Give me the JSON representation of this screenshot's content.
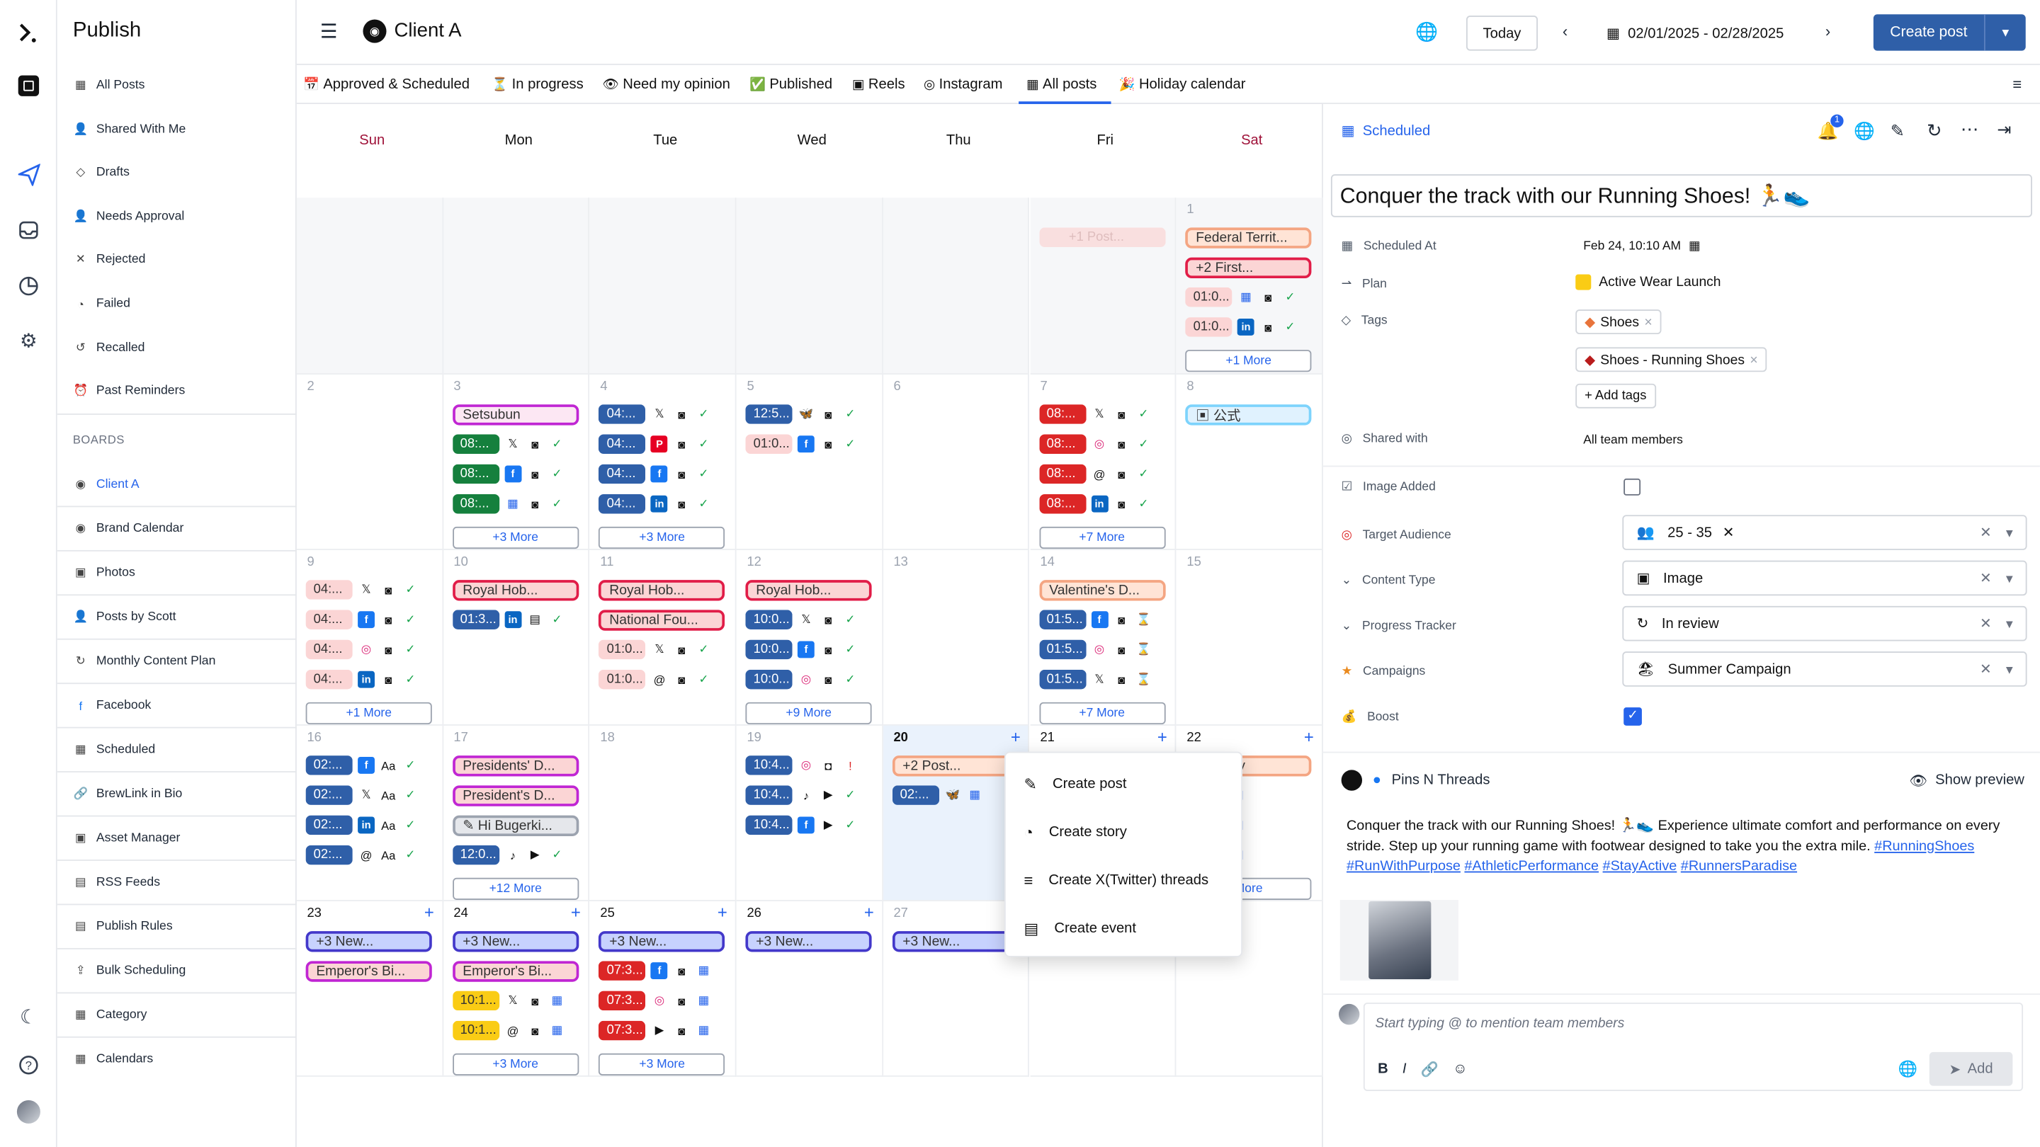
{
  "app": {
    "title": "Publish"
  },
  "sidebar": {
    "items": [
      {
        "icon": "calendar-icon",
        "label": "All Posts"
      },
      {
        "icon": "user-icon",
        "label": "Shared With Me"
      },
      {
        "icon": "draft-icon",
        "label": "Drafts"
      },
      {
        "icon": "user-check-icon",
        "label": "Needs Approval"
      },
      {
        "icon": "close-icon",
        "label": "Rejected"
      },
      {
        "icon": "clock-icon",
        "label": "Failed"
      },
      {
        "icon": "undo-icon",
        "label": "Recalled"
      },
      {
        "icon": "alarm-icon",
        "label": "Past Reminders"
      }
    ],
    "boards_title": "BOARDS",
    "boards": [
      {
        "label": "Client A",
        "active": true
      },
      {
        "label": "Brand Calendar"
      },
      {
        "label": "Photos"
      },
      {
        "label": "Posts by Scott"
      },
      {
        "label": "Monthly Content Plan"
      },
      {
        "label": "Facebook"
      },
      {
        "label": "Scheduled"
      },
      {
        "label": "BrewLink in Bio"
      },
      {
        "label": "Asset Manager"
      },
      {
        "label": "RSS Feeds"
      },
      {
        "label": "Publish Rules"
      },
      {
        "label": "Bulk Scheduling"
      },
      {
        "label": "Category"
      },
      {
        "label": "Calendars"
      }
    ]
  },
  "header": {
    "board": "Client A",
    "today": "Today",
    "range": "02/01/2025 - 02/28/2025",
    "create": "Create post"
  },
  "filters": [
    {
      "icon": "📅",
      "label": "Approved & Scheduled"
    },
    {
      "icon": "⏳",
      "label": "In progress"
    },
    {
      "icon": "👁",
      "label": "Need my opinion"
    },
    {
      "icon": "✅",
      "label": "Published"
    },
    {
      "icon": "▣",
      "label": "Reels"
    },
    {
      "icon": "◎",
      "label": "Instagram"
    },
    {
      "icon": "▦",
      "label": "All posts",
      "active": true
    },
    {
      "icon": "🎉",
      "label": "Holiday calendar"
    }
  ],
  "calendar": {
    "days": [
      "Sun",
      "Mon",
      "Tue",
      "Wed",
      "Thu",
      "Fri",
      "Sat"
    ],
    "cells": [
      {
        "n": "",
        "off": true
      },
      {
        "n": "",
        "off": true
      },
      {
        "n": "",
        "off": true
      },
      {
        "n": "",
        "off": true
      },
      {
        "n": "",
        "off": true
      },
      {
        "n": "",
        "off": true,
        "chips": [
          {
            "t": "+1 Post...",
            "c": "#fbd5d5",
            "tc": "#d4a5a5",
            "faded": true
          }
        ]
      },
      {
        "n": "1",
        "off": true,
        "events": [
          {
            "t": "Federal Territ...",
            "bg": "#ffe4d6",
            "bd": "#f4a582",
            "tc": "#333"
          },
          {
            "t": "+2  First...",
            "bg": "#fbd5d5",
            "bd": "#e11d48",
            "tc": "#333"
          }
        ],
        "chips": [
          {
            "t": "01:0...",
            "c": "#fbd5d5",
            "tc": "#333",
            "icons": [
              "▦",
              "◙",
              "✓"
            ]
          },
          {
            "t": "01:0...",
            "c": "#fbd5d5",
            "tc": "#333",
            "icons": [
              "in",
              "◙",
              "✓"
            ]
          }
        ],
        "more": "+1 More"
      },
      {
        "n": "2"
      },
      {
        "n": "3",
        "events": [
          {
            "t": "Setsubun",
            "bg": "#fce7f3",
            "bd": "#c026d3",
            "tc": "#333"
          }
        ],
        "chips": [
          {
            "t": "08:...",
            "c": "#15803d",
            "icons": [
              "𝕏",
              "◙",
              "✓"
            ]
          },
          {
            "t": "08:...",
            "c": "#15803d",
            "icons": [
              "f",
              "◙",
              "✓"
            ]
          },
          {
            "t": "08:...",
            "c": "#15803d",
            "icons": [
              "▦",
              "◙",
              "✓"
            ]
          }
        ],
        "more": "+3 More"
      },
      {
        "n": "4",
        "chips": [
          {
            "t": "04:...",
            "c": "#2f5fa8",
            "icons": [
              "𝕏",
              "◙",
              "✓"
            ]
          },
          {
            "t": "04:...",
            "c": "#2f5fa8",
            "icons": [
              "P",
              "◙",
              "✓"
            ]
          },
          {
            "t": "04:...",
            "c": "#2f5fa8",
            "icons": [
              "f",
              "◙",
              "✓"
            ]
          },
          {
            "t": "04:...",
            "c": "#2f5fa8",
            "icons": [
              "in",
              "◙",
              "✓"
            ]
          }
        ],
        "more": "+3 More"
      },
      {
        "n": "5",
        "chips": [
          {
            "t": "12:5...",
            "c": "#2f5fa8",
            "icons": [
              "🦋",
              "◙",
              "✓"
            ]
          },
          {
            "t": "01:0...",
            "c": "#fbd5d5",
            "tc": "#333",
            "icons": [
              "f",
              "◙",
              "✓"
            ]
          }
        ]
      },
      {
        "n": "6"
      },
      {
        "n": "7",
        "chips": [
          {
            "t": "08:...",
            "c": "#dc2626",
            "icons": [
              "𝕏",
              "◙",
              "✓"
            ]
          },
          {
            "t": "08:...",
            "c": "#dc2626",
            "icons": [
              "◎",
              "◙",
              "✓"
            ]
          },
          {
            "t": "08:...",
            "c": "#dc2626",
            "icons": [
              "@",
              "◙",
              "✓"
            ]
          },
          {
            "t": "08:...",
            "c": "#dc2626",
            "icons": [
              "in",
              "◙",
              "✓"
            ]
          }
        ],
        "more": "+7 More"
      },
      {
        "n": "8",
        "events": [
          {
            "t": "▣  公式",
            "bg": "#e0f2fe",
            "bd": "#7dd3fc",
            "tc": "#333"
          }
        ]
      },
      {
        "n": "9",
        "chips": [
          {
            "t": "04:...",
            "c": "#fbd5d5",
            "tc": "#333",
            "icons": [
              "𝕏",
              "◙",
              "✓"
            ]
          },
          {
            "t": "04:...",
            "c": "#fbd5d5",
            "tc": "#333",
            "icons": [
              "f",
              "◙",
              "✓"
            ]
          },
          {
            "t": "04:...",
            "c": "#fbd5d5",
            "tc": "#333",
            "icons": [
              "◎",
              "◙",
              "✓"
            ]
          },
          {
            "t": "04:...",
            "c": "#fbd5d5",
            "tc": "#333",
            "icons": [
              "in",
              "◙",
              "✓"
            ]
          }
        ],
        "more": "+1 More"
      },
      {
        "n": "10",
        "events": [
          {
            "t": "Royal Hob...",
            "bg": "#fbd5d5",
            "bd": "#e11d48",
            "tc": "#333"
          }
        ],
        "chips": [
          {
            "t": "01:3...",
            "c": "#2f5fa8",
            "icons": [
              "in",
              "▤",
              "✓"
            ]
          }
        ]
      },
      {
        "n": "11",
        "events": [
          {
            "t": "Royal Hob...",
            "bg": "#fbd5d5",
            "bd": "#e11d48",
            "tc": "#333"
          },
          {
            "t": "National Fou...",
            "bg": "#fbd5d5",
            "bd": "#e11d48",
            "tc": "#333"
          }
        ],
        "chips": [
          {
            "t": "01:0...",
            "c": "#fbd5d5",
            "tc": "#333",
            "icons": [
              "𝕏",
              "◙",
              "✓"
            ]
          },
          {
            "t": "01:0...",
            "c": "#fbd5d5",
            "tc": "#333",
            "icons": [
              "@",
              "◙",
              "✓"
            ]
          }
        ]
      },
      {
        "n": "12",
        "events": [
          {
            "t": "Royal Hob...",
            "bg": "#fbd5d5",
            "bd": "#e11d48",
            "tc": "#333"
          }
        ],
        "chips": [
          {
            "t": "10:0...",
            "c": "#2f5fa8",
            "icons": [
              "𝕏",
              "◙",
              "✓"
            ]
          },
          {
            "t": "10:0...",
            "c": "#2f5fa8",
            "icons": [
              "f",
              "◙",
              "✓"
            ]
          },
          {
            "t": "10:0...",
            "c": "#2f5fa8",
            "icons": [
              "◎",
              "◙",
              "✓"
            ]
          }
        ],
        "more": "+9 More"
      },
      {
        "n": "13"
      },
      {
        "n": "14",
        "events": [
          {
            "t": "Valentine's D...",
            "bg": "#ffe4d6",
            "bd": "#f4a582",
            "tc": "#333"
          }
        ],
        "chips": [
          {
            "t": "01:5...",
            "c": "#2f5fa8",
            "icons": [
              "f",
              "◙",
              "⌛"
            ]
          },
          {
            "t": "01:5...",
            "c": "#2f5fa8",
            "icons": [
              "◎",
              "◙",
              "⌛"
            ]
          },
          {
            "t": "01:5...",
            "c": "#2f5fa8",
            "icons": [
              "𝕏",
              "◙",
              "⌛"
            ]
          }
        ],
        "more": "+7 More"
      },
      {
        "n": "15"
      },
      {
        "n": "16",
        "chips": [
          {
            "t": "02:...",
            "c": "#2f5fa8",
            "icons": [
              "f",
              "Aa",
              "✓"
            ]
          },
          {
            "t": "02:...",
            "c": "#2f5fa8",
            "icons": [
              "𝕏",
              "Aa",
              "✓"
            ]
          },
          {
            "t": "02:...",
            "c": "#2f5fa8",
            "icons": [
              "in",
              "Aa",
              "✓"
            ]
          },
          {
            "t": "02:...",
            "c": "#2f5fa8",
            "icons": [
              "@",
              "Aa",
              "✓"
            ]
          }
        ]
      },
      {
        "n": "17",
        "events": [
          {
            "t": "Presidents' D...",
            "bg": "#fbd5d5",
            "bd": "#c026d3",
            "tc": "#333"
          },
          {
            "t": "President's D...",
            "bg": "#fbd5d5",
            "bd": "#c026d3",
            "tc": "#333"
          },
          {
            "t": "✎  Hi Bugerki...",
            "bg": "#e5e7eb",
            "bd": "#9ca3af",
            "tc": "#333"
          }
        ],
        "chips": [
          {
            "t": "12:0...",
            "c": "#2f5fa8",
            "icons": [
              "♪",
              "▶",
              "✓"
            ]
          }
        ],
        "more": "+12 More"
      },
      {
        "n": "18"
      },
      {
        "n": "19",
        "chips": [
          {
            "t": "10:4...",
            "c": "#2f5fa8",
            "icons": [
              "◎",
              "◘",
              "!"
            ]
          },
          {
            "t": "10:4...",
            "c": "#2f5fa8",
            "icons": [
              "♪",
              "▶",
              "✓"
            ]
          },
          {
            "t": "10:4...",
            "c": "#2f5fa8",
            "icons": [
              "f",
              "▶",
              "✓"
            ]
          }
        ]
      },
      {
        "n": "20",
        "today": true,
        "plus": true,
        "events": [
          {
            "t": "+2  Post...",
            "bg": "#ffe4d6",
            "bd": "#f4a582",
            "tc": "#333"
          }
        ],
        "chips": [
          {
            "t": "02:...",
            "c": "#2f5fa8",
            "icons": [
              "🦋",
              "▦"
            ]
          }
        ]
      },
      {
        "n": "21",
        "plus": true
      },
      {
        "n": "22",
        "plus": true,
        "events": [
          {
            "t": "ling Day",
            "bg": "#ffe4d6",
            "bd": "#f4a582",
            "tc": "#333"
          }
        ],
        "chips": [
          {
            "t": "",
            "c": "transparent",
            "icons": [
              "𝕏",
              "▶",
              "▦"
            ]
          },
          {
            "t": "",
            "c": "transparent",
            "icons": [
              "◎",
              "◘",
              "▦"
            ]
          },
          {
            "t": "",
            "c": "transparent",
            "icons": [
              "▶",
              "◘",
              "▦"
            ]
          }
        ],
        "more": "More"
      },
      {
        "n": "23",
        "plus": true,
        "events": [
          {
            "t": "+3  New...",
            "bg": "#c7d2fe",
            "bd": "#4338ca",
            "tc": "#333"
          },
          {
            "t": "Emperor's Bi...",
            "bg": "#fbd5d5",
            "bd": "#c026d3",
            "tc": "#333"
          }
        ]
      },
      {
        "n": "24",
        "plus": true,
        "events": [
          {
            "t": "+3  New...",
            "bg": "#c7d2fe",
            "bd": "#4338ca",
            "tc": "#333"
          },
          {
            "t": "Emperor's Bi...",
            "bg": "#fbd5d5",
            "bd": "#c026d3",
            "tc": "#333"
          }
        ],
        "chips": [
          {
            "t": "10:1...",
            "c": "#facc15",
            "tc": "#333",
            "icons": [
              "𝕏",
              "◙",
              "▦"
            ]
          },
          {
            "t": "10:1...",
            "c": "#facc15",
            "tc": "#333",
            "icons": [
              "@",
              "◙",
              "▦"
            ]
          }
        ],
        "more": "+3 More"
      },
      {
        "n": "25",
        "plus": true,
        "events": [
          {
            "t": "+3  New...",
            "bg": "#c7d2fe",
            "bd": "#4338ca",
            "tc": "#333"
          }
        ],
        "chips": [
          {
            "t": "07:3...",
            "c": "#dc2626",
            "icons": [
              "f",
              "◙",
              "▦"
            ]
          },
          {
            "t": "07:3...",
            "c": "#dc2626",
            "icons": [
              "◎",
              "◙",
              "▦"
            ]
          },
          {
            "t": "07:3...",
            "c": "#dc2626",
            "icons": [
              "▶",
              "◙",
              "▦"
            ]
          }
        ],
        "more": "+3 More"
      },
      {
        "n": "26",
        "plus": true,
        "events": [
          {
            "t": "+3  New...",
            "bg": "#c7d2fe",
            "bd": "#4338ca",
            "tc": "#333"
          }
        ]
      },
      {
        "n": "27",
        "events": [
          {
            "t": "+3  New...",
            "bg": "#c7d2fe",
            "bd": "#4338ca",
            "tc": "#333"
          }
        ]
      },
      {
        "n": ""
      },
      {
        "n": ""
      }
    ]
  },
  "context_menu": {
    "items": [
      {
        "icon": "✎",
        "label": "Create post"
      },
      {
        "icon": "◔",
        "label": "Create story"
      },
      {
        "icon": "≡",
        "label": "Create X(Twitter) threads"
      },
      {
        "icon": "▤",
        "label": "Create event"
      }
    ]
  },
  "panel": {
    "status": "Scheduled",
    "badge": "1",
    "title": "Conquer the track with our Running Shoes! 🏃👟",
    "fields": {
      "scheduled_at_label": "Scheduled At",
      "scheduled_at": "Feb 24, 10:10 AM",
      "plan_label": "Plan",
      "plan": "Active Wear Launch",
      "tags_label": "Tags",
      "tag1": "Shoes",
      "tag2": "Shoes - Running Shoes",
      "add_tags": "+ Add tags",
      "shared_label": "Shared with",
      "shared": "All team members",
      "image_added_label": "Image Added",
      "target_label": "Target Audience",
      "target": "25 - 35",
      "content_type_label": "Content Type",
      "content_type": "Image",
      "progress_label": "Progress Tracker",
      "progress": "In review",
      "campaigns_label": "Campaigns",
      "campaigns": "Summer Campaign",
      "boost_label": "Boost"
    },
    "preview": {
      "account": "Pins N Threads",
      "show_preview": "Show preview",
      "text": "Conquer the track with our Running Shoes! 🏃👟 Experience ultimate comfort and performance on every stride. Step up your running game with footwear designed to take you the extra mile.",
      "hashtags": [
        "#RunningShoes",
        "#RunWithPurpose",
        "#AthleticPerformance",
        "#StayActive",
        "#RunnersParadise"
      ]
    },
    "comment": {
      "placeholder": "Start typing @ to mention team members",
      "add": "Add"
    }
  },
  "colors": {
    "accent": "#2563eb",
    "create_btn": "#2f5fa8"
  }
}
